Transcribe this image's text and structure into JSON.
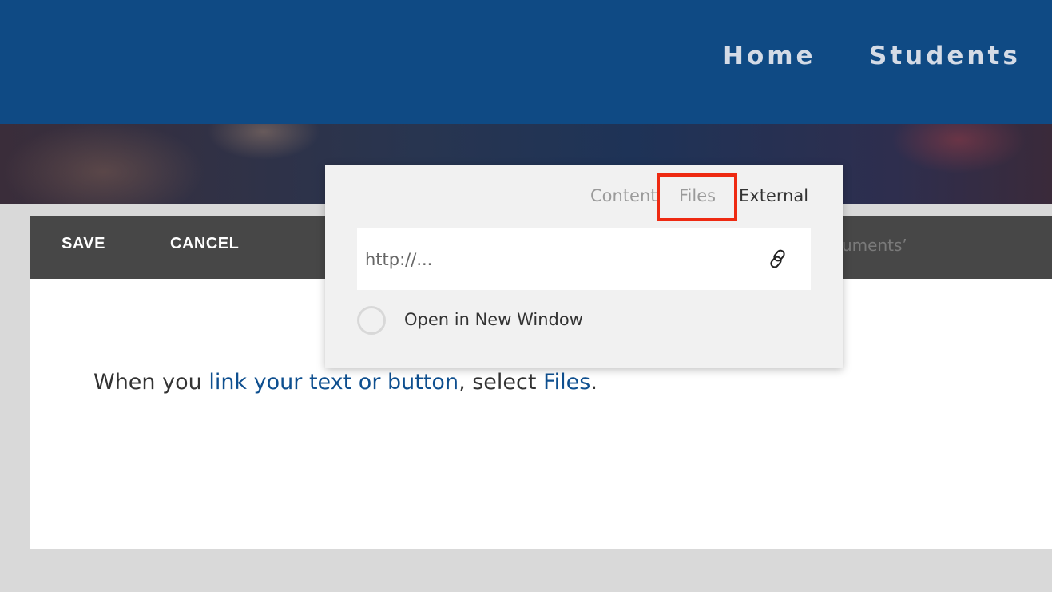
{
  "nav": {
    "home_label": "Home",
    "students_label": "Students"
  },
  "toolbar": {
    "save_label": "SAVE",
    "cancel_label": "CANCEL",
    "right_text": "cuments’"
  },
  "editor": {
    "text_before": "When you ",
    "link_text_1": "link your text or button",
    "text_middle": ", select ",
    "link_text_2": "Files",
    "text_after": "."
  },
  "link_popup": {
    "tabs": [
      {
        "label": "Content",
        "active": false
      },
      {
        "label": "Files",
        "active": false,
        "highlighted": true
      },
      {
        "label": "External",
        "active": true
      }
    ],
    "url_placeholder": "http://...",
    "link_icon": "link-icon",
    "open_new_window_label": "Open in New Window",
    "highlight_color": "#ee2a12"
  },
  "colors": {
    "header_bg": "#0f4a84",
    "toolbar_bg": "#474747",
    "link_color": "#0e4f8f"
  }
}
